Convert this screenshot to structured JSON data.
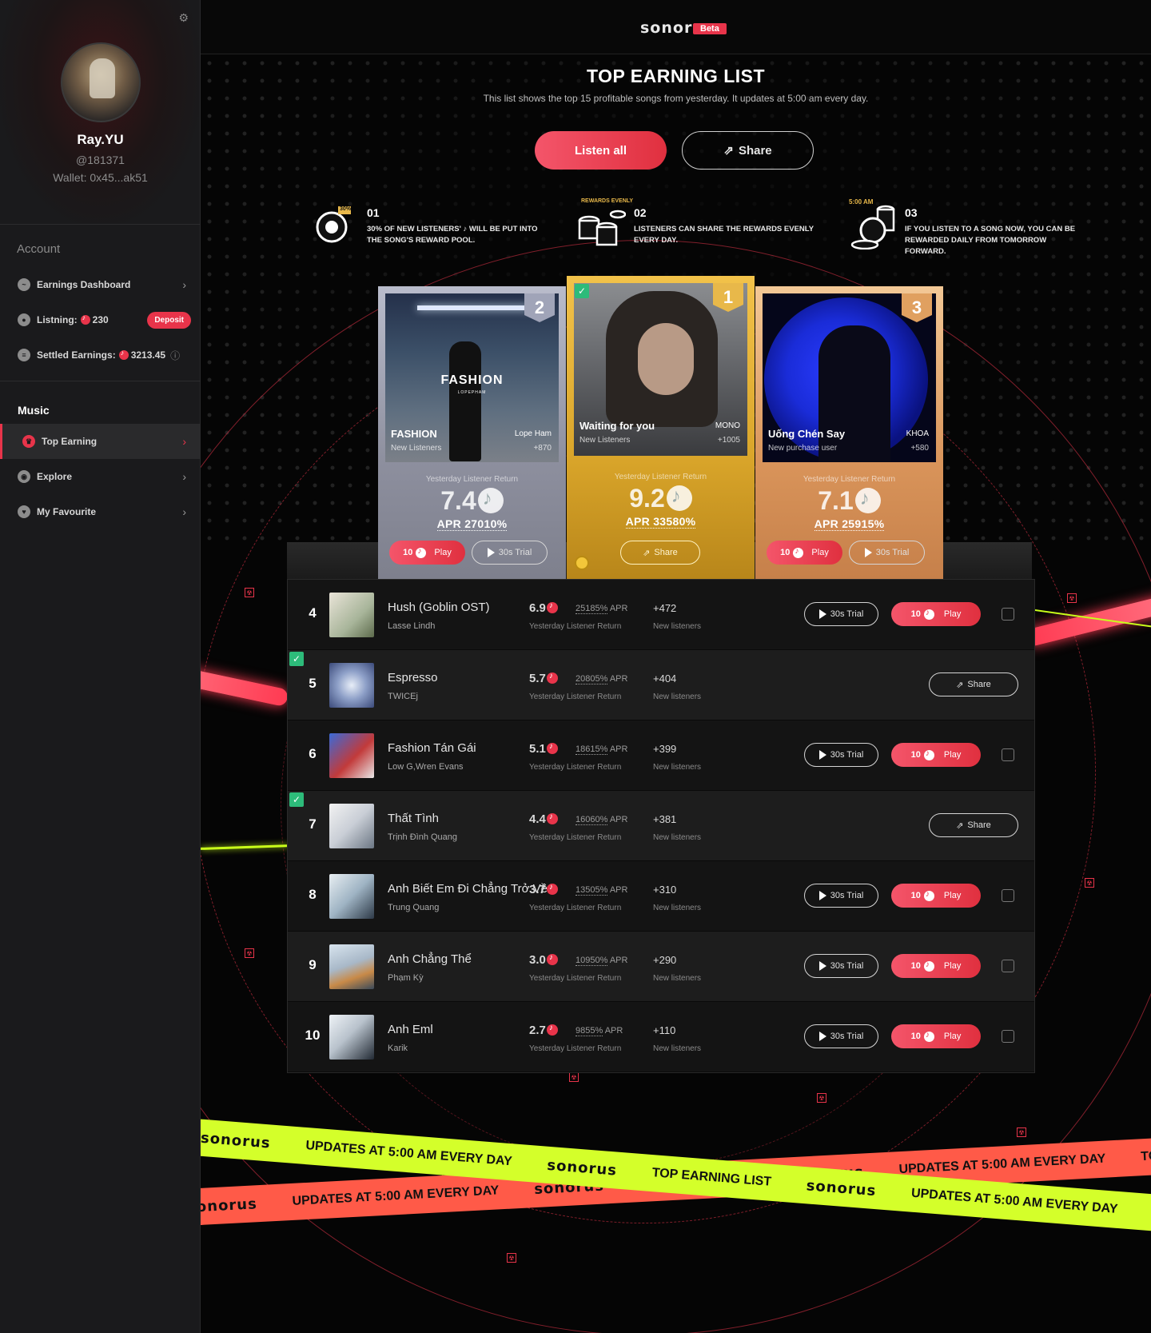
{
  "sidebar": {
    "user": {
      "name": "Ray.YU",
      "handle": "@181371",
      "wallet": "Wallet: 0x45...ak51"
    },
    "account_title": "Account",
    "account_items": [
      {
        "label": "Earnings Dashboard",
        "icon": "chart-icon"
      },
      {
        "label": "Listning:",
        "value": "230",
        "icon": "disc-icon",
        "badge": "Deposit"
      },
      {
        "label": "Settled Earnings:",
        "value": "3213.45",
        "icon": "database-icon"
      }
    ],
    "music_title": "Music",
    "music_items": [
      {
        "label": "Top Earning",
        "icon": "trophy-icon",
        "active": true
      },
      {
        "label": "Explore",
        "icon": "explore-icon"
      },
      {
        "label": "My Favourite",
        "icon": "heart-icon"
      }
    ]
  },
  "header": {
    "logo": "sonorus",
    "badge": "Beta"
  },
  "hero": {
    "title": "TOP EARNING LIST",
    "subtitle": "This list shows the top 15 profitable songs from yesterday. It updates at 5:00 am every day.",
    "listen_all": "Listen all",
    "share": "Share"
  },
  "steps": [
    {
      "num": "01",
      "badge": "30%",
      "text": "30% OF NEW LISTENERS' ♪ WILL BE PUT INTO THE SONG'S REWARD POOL."
    },
    {
      "num": "02",
      "badge": "REWARDS EVENLY",
      "text": "LISTENERS CAN SHARE THE REWARDS EVENLY EVERY DAY."
    },
    {
      "num": "03",
      "badge": "5:00 AM",
      "text": "IF YOU LISTEN TO A SONG NOW, YOU CAN BE REWARDED DAILY FROM TOMORROW FORWARD."
    }
  ],
  "podium": [
    {
      "rank": "2",
      "title": "FASHION",
      "cover_text": "FASHION",
      "cover_sub": "LOPEPHAM",
      "artist": "Lope Ham",
      "new_label": "New Listeners",
      "new_value": "+870",
      "return_label": "Yesterday Listener Return",
      "value": "7.4",
      "apr": "APR 27010%",
      "play": "10",
      "play_label": "Play",
      "trial": "30s Trial"
    },
    {
      "rank": "1",
      "title": "Waiting for you",
      "artist": "MONO",
      "new_label": "New Listeners",
      "new_value": "+1005",
      "return_label": "Yesterday Listener Return",
      "value": "9.2",
      "apr": "APR 33580%",
      "share": "Share"
    },
    {
      "rank": "3",
      "title": "Uống Chén Say",
      "artist": "KHOA",
      "new_label": "New purchase user",
      "new_value": "+580",
      "return_label": "Yesterday Listener Return",
      "value": "7.1",
      "apr": "APR 25915%",
      "play": "10",
      "play_label": "Play",
      "trial": "30s Trial"
    }
  ],
  "list": [
    {
      "rank": "4",
      "title": "Hush (Goblin OST)",
      "artist": "Lasse Lindh",
      "value": "6.9",
      "apr": "25185%",
      "apr_label": "APR",
      "return_label": "Yesterday Listener Return",
      "new": "+472",
      "new_label": "New listeners",
      "mode": "play",
      "trial": "30s Trial",
      "play": "10",
      "play_label": "Play"
    },
    {
      "rank": "5",
      "title": "Espresso",
      "artist": "TWICEj",
      "value": "5.7",
      "apr": "20805%",
      "apr_label": "APR",
      "return_label": "Yesterday Listener Return",
      "new": "+404",
      "new_label": "New listeners",
      "mode": "share",
      "share": "Share",
      "checked": true
    },
    {
      "rank": "6",
      "title": "Fashion Tán Gái",
      "artist": "Low G,Wren Evans",
      "value": "5.1",
      "apr": "18615%",
      "apr_label": "APR",
      "return_label": "Yesterday Listener Return",
      "new": "+399",
      "new_label": "New listeners",
      "mode": "play",
      "trial": "30s Trial",
      "play": "10",
      "play_label": "Play"
    },
    {
      "rank": "7",
      "title": "Thất Tình",
      "artist": "Trịnh Đình Quang",
      "value": "4.4",
      "apr": "16060%",
      "apr_label": "APR",
      "return_label": "Yesterday Listener Return",
      "new": "+381",
      "new_label": "New listeners",
      "mode": "share",
      "share": "Share",
      "checked": true
    },
    {
      "rank": "8",
      "title": "Anh Biết Em Đi Chẳng Trở Về",
      "artist": "Trung Quang",
      "value": "3.7",
      "apr": "13505%",
      "apr_label": "APR",
      "return_label": "Yesterday Listener Return",
      "new": "+310",
      "new_label": "New listeners",
      "mode": "play",
      "trial": "30s Trial",
      "play": "10",
      "play_label": "Play"
    },
    {
      "rank": "9",
      "title": "Anh Chẳng Thể",
      "artist": "Phạm Kỳ",
      "value": "3.0",
      "apr": "10950%",
      "apr_label": "APR",
      "return_label": "Yesterday Listener Return",
      "new": "+290",
      "new_label": "New listeners",
      "mode": "play",
      "trial": "30s Trial",
      "play": "10",
      "play_label": "Play"
    },
    {
      "rank": "10",
      "title": "Anh Eml",
      "artist": "Karik",
      "value": "2.7",
      "apr": "9855%",
      "apr_label": "APR",
      "return_label": "Yesterday Listener Return",
      "new": "+110",
      "new_label": "New listeners",
      "mode": "play",
      "trial": "30s Trial",
      "play": "10",
      "play_label": "Play"
    }
  ],
  "tapes": {
    "logo": "sonorus",
    "updates": "UPDATES AT 5:00 AM EVERY DAY",
    "top": "TOP EARNING LIST"
  },
  "colors": {
    "accent": "#e8344a",
    "gold": "#e8b84a",
    "lime": "#d4ff2a",
    "coral": "#ff5a4a"
  }
}
